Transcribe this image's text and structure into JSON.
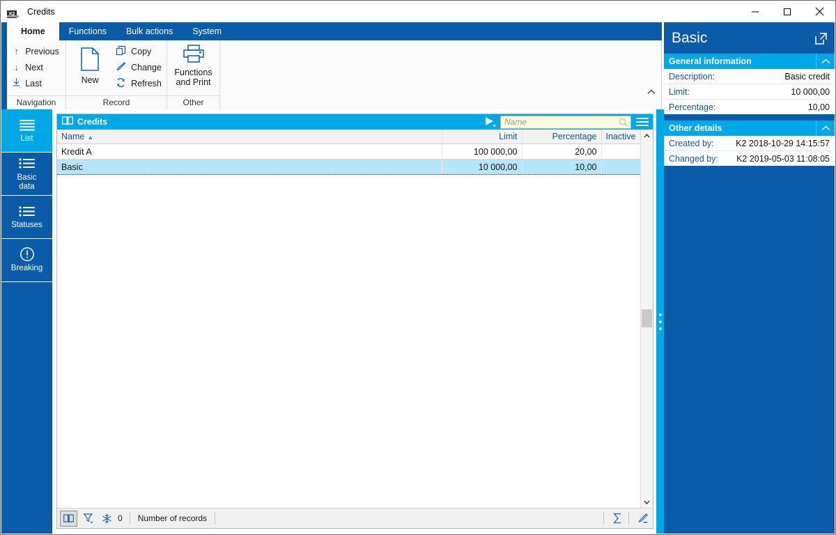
{
  "window": {
    "title": "Credits",
    "app_icon": "k2-app-icon",
    "minimize": "minimize-icon",
    "maximize": "maximize-icon",
    "close": "close-icon"
  },
  "ribbon": {
    "tabs": [
      {
        "label": "Home",
        "active": true
      },
      {
        "label": "Functions",
        "active": false
      },
      {
        "label": "Bulk actions",
        "active": false
      },
      {
        "label": "System",
        "active": false
      }
    ],
    "groups": [
      {
        "label": "Navigation",
        "items": [
          {
            "label": "Previous",
            "icon": "arrow-up-icon"
          },
          {
            "label": "Next",
            "icon": "arrow-down-icon"
          },
          {
            "label": "Last",
            "icon": "arrow-to-bottom-icon"
          }
        ]
      },
      {
        "label": "Record",
        "big": {
          "label": "New",
          "icon": "new-document-icon"
        },
        "items": [
          {
            "label": "Copy",
            "icon": "copy-icon"
          },
          {
            "label": "Change",
            "icon": "pencil-icon"
          },
          {
            "label": "Refresh",
            "icon": "refresh-icon"
          }
        ]
      },
      {
        "label": "Other",
        "big": {
          "label": "Functions\nand Print",
          "line1": "Functions",
          "line2": "and Print",
          "icon": "printer-icon"
        }
      }
    ],
    "collapse_icon": "chevron-up-icon"
  },
  "sidebar": {
    "items": [
      {
        "label": "List",
        "icon": "list-lines-icon",
        "active": true
      },
      {
        "label": "Basic\ndata",
        "line1": "Basic",
        "line2": "data",
        "icon": "bullet-list-icon",
        "active": false
      },
      {
        "label": "Statuses",
        "icon": "bullet-list-icon",
        "active": false
      },
      {
        "label": "Breaking",
        "icon": "exclamation-circle-icon",
        "active": false
      }
    ]
  },
  "list": {
    "title": "Credits",
    "title_icon": "book-icon",
    "play_icon": "play-filled-icon",
    "menu_icon": "hamburger-icon",
    "search": {
      "placeholder": "Name",
      "value": "",
      "icon": "magnifier-icon"
    },
    "columns": [
      {
        "label": "Name",
        "align": "left",
        "sorted": "asc",
        "sort_icon": "caret-up-icon"
      },
      {
        "label": "Limit",
        "align": "right"
      },
      {
        "label": "Percentage",
        "align": "right"
      },
      {
        "label": "Inactive",
        "align": "left"
      }
    ],
    "rows": [
      {
        "name": "Kredit A",
        "limit": "100 000,00",
        "percentage": "20,00",
        "inactive": "",
        "selected": false
      },
      {
        "name": "Basic",
        "limit": "10 000,00",
        "percentage": "10,00",
        "inactive": "",
        "selected": true
      }
    ],
    "scroll": {
      "up_icon": "chevron-up-icon",
      "down_icon": "chevron-down-icon"
    }
  },
  "statusbar": {
    "book_icon": "book-view-icon",
    "filter_icon": "funnel-filter-icon",
    "snowflake_icon": "snowflake-icon",
    "count": "0",
    "records_label": "Number of records",
    "sum_icon": "sigma-sum-icon",
    "edit_icon": "pencil-edit-icon"
  },
  "splitter": {
    "handle_icon": "splitter-dots-icon"
  },
  "details": {
    "title": "Basic",
    "popout_icon": "pop-out-icon",
    "sections": [
      {
        "title": "General information",
        "chevron_icon": "chevron-up-icon",
        "rows": [
          {
            "label": "Description:",
            "value": "Basic credit"
          },
          {
            "label": "Limit:",
            "value": "10 000,00"
          },
          {
            "label": "Percentage:",
            "value": "10,00"
          }
        ]
      },
      {
        "title": "Other details",
        "chevron_icon": "chevron-up-icon",
        "rows": [
          {
            "label": "Created by:",
            "value": "K2 2018-10-29 14:15:57"
          },
          {
            "label": "Changed by:",
            "value": "K2 2019-05-03 11:08:05"
          }
        ]
      }
    ]
  },
  "colors": {
    "ribbon_blue": "#0a5ba8",
    "accent_cyan": "#00a8e8",
    "selection": "#b5e5fb",
    "link_blue": "#15548f"
  }
}
